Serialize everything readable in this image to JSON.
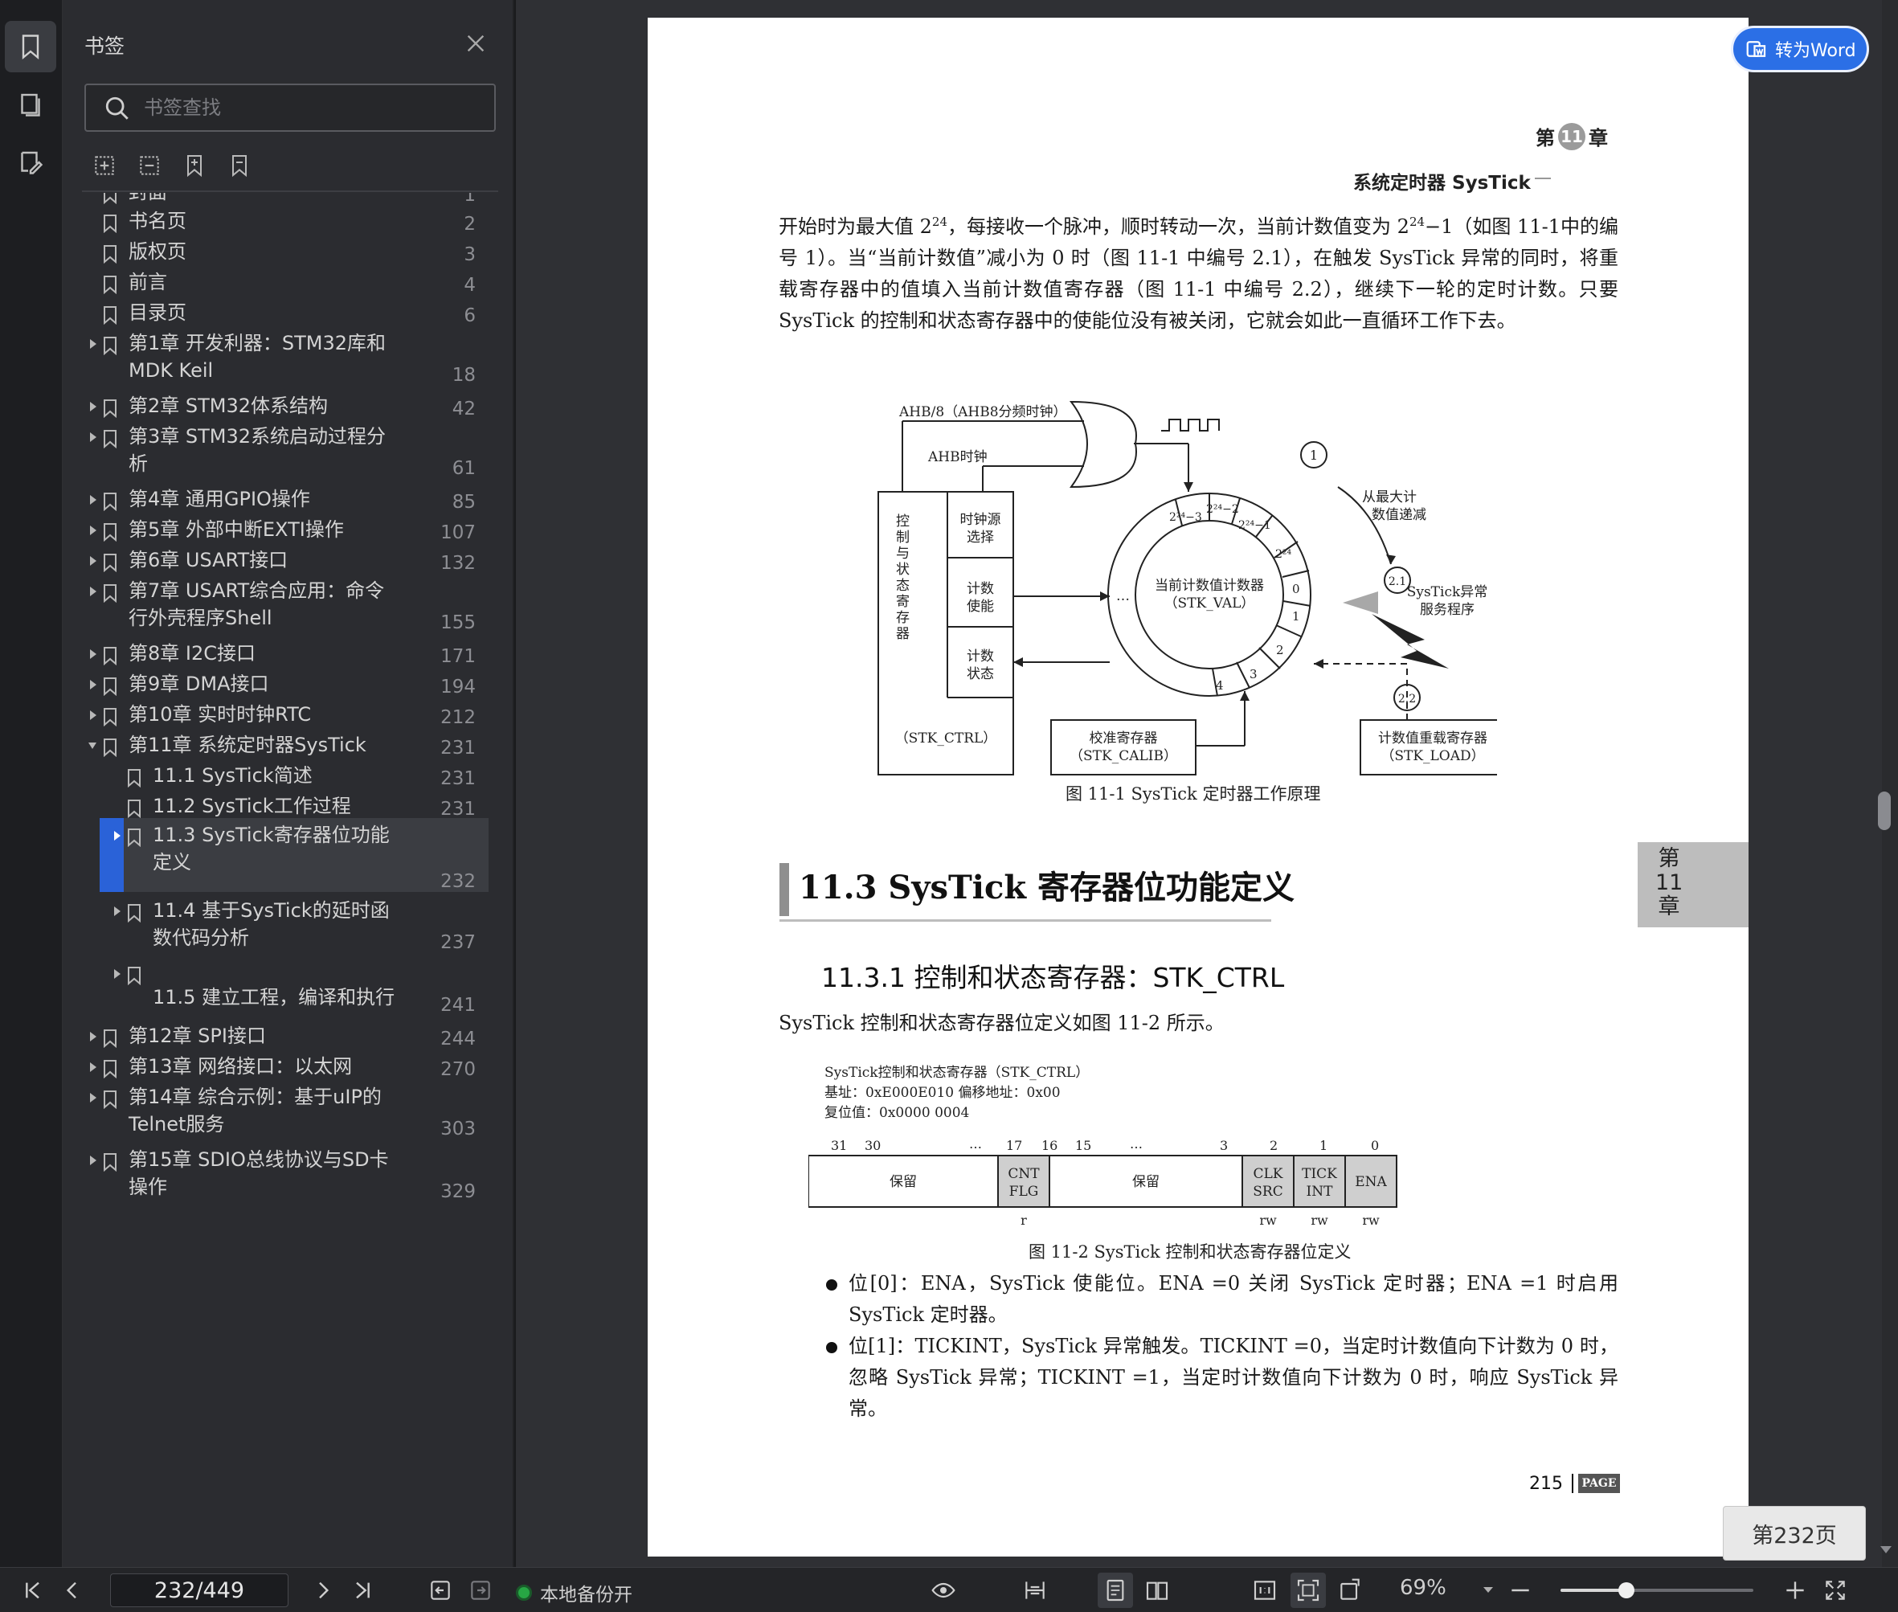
{
  "panel": {
    "title": "书签",
    "search_placeholder": "书签查找",
    "items": [
      {
        "label": "封面",
        "page": "1"
      },
      {
        "label": "书名页",
        "page": "2"
      },
      {
        "label": "版权页",
        "page": "3"
      },
      {
        "label": "前言",
        "page": "4"
      },
      {
        "label": "目录页",
        "page": "6"
      },
      {
        "label": "第1章  开发利器：STM32库和\nMDK Keil",
        "page": "18"
      },
      {
        "label": "第2章  STM32体系结构",
        "page": "42"
      },
      {
        "label": "第3章  STM32系统启动过程分\n析",
        "page": "61"
      },
      {
        "label": "第4章  通用GPIO操作",
        "page": "85"
      },
      {
        "label": "第5章  外部中断EXTI操作",
        "page": "107"
      },
      {
        "label": "第6章  USART接口",
        "page": "132"
      },
      {
        "label": "第7章  USART综合应用：命令\n行外壳程序Shell",
        "page": "155"
      },
      {
        "label": "第8章  I2C接口",
        "page": "171"
      },
      {
        "label": "第9章  DMA接口",
        "page": "194"
      },
      {
        "label": "第10章  实时时钟RTC",
        "page": "212"
      },
      {
        "label": "第11章  系统定时器SysTick",
        "page": "231"
      },
      {
        "label": "11.1  SysTick简述",
        "page": "231"
      },
      {
        "label": "11.2  SysTick工作过程",
        "page": "231"
      },
      {
        "label": "11.3  SysTick寄存器位功能\n定义",
        "page": "232"
      },
      {
        "label": "11.4  基于SysTick的延时函\n数代码分析",
        "page": "237"
      },
      {
        "label": "11.5  建立工程，编译和执行",
        "page": "241"
      },
      {
        "label": "第12章  SPI接口",
        "page": "244"
      },
      {
        "label": "第13章  网络接口：以太网",
        "page": "270"
      },
      {
        "label": "第14章  综合示例：基于uIP的\nTelnet服务",
        "page": "303"
      },
      {
        "label": "第15章  SDIO总线协议与SD卡\n操作",
        "page": "329"
      }
    ]
  },
  "doc": {
    "header_chapter_pre": "第",
    "header_chapter_num": "11",
    "header_chapter_post": "章",
    "header_title": "系统定时器 SysTick",
    "para1_html": "开始时为最大值 2<sup>24</sup>，每接收一个脉冲，顺时转动一次，当前计数值变为 2<sup>24</sup>−1（如图 11-1中的编号 1）。当“当前计数值”减小为 0 时（图 11-1 中编号 2.1），在触发 SysTick 异常的同时，将重载寄存器中的值填入当前计数值寄存器（图 11-1 中编号 2.2），继续下一轮的定时计数。只要 SysTick 的控制和状态寄存器中的使能位没有被关闭，它就会如此一直循环工作下去。",
    "fig1": {
      "ahb8": "AHB/8（AHB8分频时钟）",
      "ahb": "AHB时钟",
      "ctrl_vertical": [
        "控",
        "制",
        "与",
        "状",
        "态",
        "寄",
        "存",
        "器"
      ],
      "clk_src": [
        "时钟源",
        "选择"
      ],
      "cnt_en": [
        "计数",
        "使能"
      ],
      "cnt_status": [
        "计数",
        "状态"
      ],
      "stk_ctrl": "（STK_CTRL）",
      "cur_val": [
        "当前计数值计数器",
        "（STK_VAL）"
      ],
      "dots": "…",
      "ring_24_3": "2²⁴−3",
      "ring_24_2": "2²⁴−2",
      "ring_24_1": "2²⁴−1",
      "ring_24": "2²⁴",
      "ring_0": "0",
      "ring_1": "1",
      "ring_2": "2",
      "ring_3": "3",
      "ring_4": "4",
      "calib": [
        "校准寄存器",
        "（STK_CALIB）"
      ],
      "load": [
        "计数值重载寄存器",
        "（STK_LOAD）"
      ],
      "count_down": [
        "从最大计",
        "数值递减"
      ],
      "isr": [
        "SysTick异常",
        "服务程序"
      ],
      "n1": "1",
      "n21": "2.1",
      "n22": "2.2"
    },
    "caption1": "图 11-1    SysTick 定时器工作原理",
    "section_title": "11.3    SysTick 寄存器位功能定义",
    "subsection_title": "11.3.1    控制和状态寄存器：STK_CTRL",
    "intro": "SysTick 控制和状态寄存器位定义如图 11-2 所示。",
    "fig2": {
      "reg_name": "SysTick控制和状态寄存器（STK_CTRL）",
      "base": "基址：0xE000E010        偏移地址：0x00",
      "reset": "复位值：0x0000 0004",
      "bit31": "31",
      "bit30": "30",
      "dots1": "…",
      "bit17": "17",
      "bit16": "16",
      "bit15": "15",
      "dots2": "…",
      "bit3": "3",
      "bit2": "2",
      "bit1": "1",
      "bit0": "0",
      "reserved1": "保留",
      "cntflg": [
        "CNT",
        "FLG"
      ],
      "reserved2": "保留",
      "clksrc": [
        "CLK",
        "SRC"
      ],
      "tickint": [
        "TICK",
        "INT"
      ],
      "ena": "ENA",
      "acc_r": "r",
      "acc_rw1": "rw",
      "acc_rw2": "rw",
      "acc_rw3": "rw"
    },
    "caption2": "图 11-2    SysTick 控制和状态寄存器位定义",
    "bullet1": "位[0]：ENA，SysTick 使能位。ENA =0 关闭 SysTick 定时器；ENA =1 时启用 SysTick 定时器。",
    "bullet2": "位[1]：TICKINT，SysTick 异常触发。TICKINT =0，当定时计数值向下计数为 0 时，忽略 SysTick 异常；TICKINT =1，当定时计数值向下计数为 0 时，响应 SysTick 异常。",
    "side_tab": "第\n11\n章",
    "footer_num": "215",
    "footer_page": "PAGE"
  },
  "to_word": "转为Word",
  "page_badge": "第232页",
  "bottom": {
    "page_value": "232/449",
    "backup_label": "本地备份开",
    "zoom": "69%",
    "zoom_level": 0.34
  }
}
